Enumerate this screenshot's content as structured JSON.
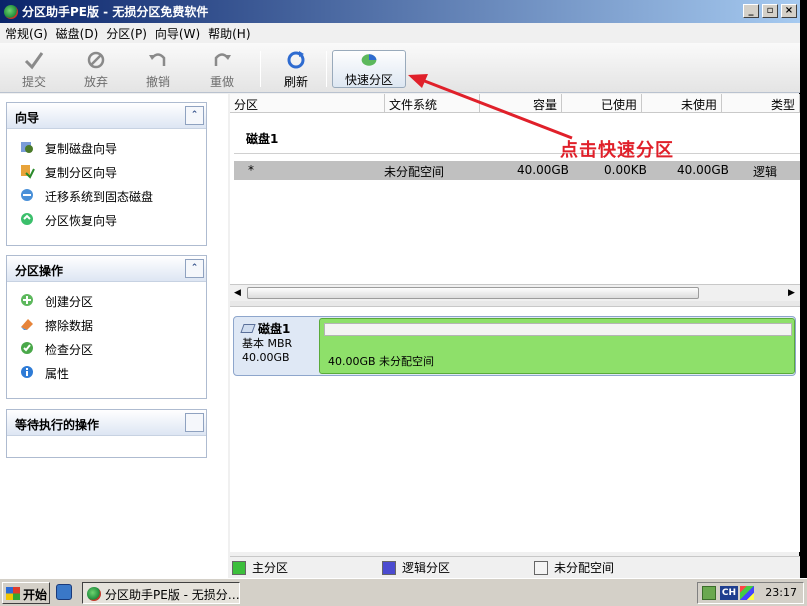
{
  "window": {
    "title": "分区助手PE版 - 无损分区免费软件"
  },
  "menu": [
    "常规(G)",
    "磁盘(D)",
    "分区(P)",
    "向导(W)",
    "帮助(H)"
  ],
  "toolbar": {
    "commit": "提交",
    "discard": "放弃",
    "undo": "撤销",
    "redo": "重做",
    "refresh": "刷新",
    "quick_partition": "快速分区"
  },
  "wizard_group": {
    "title": "向导",
    "items": [
      "复制磁盘向导",
      "复制分区向导",
      "迁移系统到固态磁盘",
      "分区恢复向导"
    ]
  },
  "ops_group": {
    "title": "分区操作",
    "items": [
      "创建分区",
      "擦除数据",
      "检查分区",
      "属性"
    ]
  },
  "pending_group": {
    "title": "等待执行的操作"
  },
  "columns": [
    "分区",
    "文件系统",
    "容量",
    "已使用",
    "未使用",
    "类型"
  ],
  "disk": {
    "label": "磁盘1",
    "row": {
      "partition": "*",
      "fs": "未分配空间",
      "capacity": "40.00GB",
      "used": "0.00KB",
      "free": "40.00GB",
      "type": "逻辑"
    }
  },
  "diskmap": {
    "name": "磁盘1",
    "kind": "基本 MBR",
    "size": "40.00GB",
    "partition_text": "40.00GB 未分配空间"
  },
  "legend": [
    "主分区",
    "逻辑分区",
    "未分配空间"
  ],
  "annotation": "点击快速分区",
  "taskbar": {
    "start": "开始",
    "app": "分区助手PE版 - 无损分…",
    "ime": "CH",
    "time": "23:17"
  },
  "colors": {
    "primary": "#3cbf3c",
    "logical": "#4b4bd0",
    "unallocated": "#f4f4f4",
    "annotation": "#e0202a"
  }
}
